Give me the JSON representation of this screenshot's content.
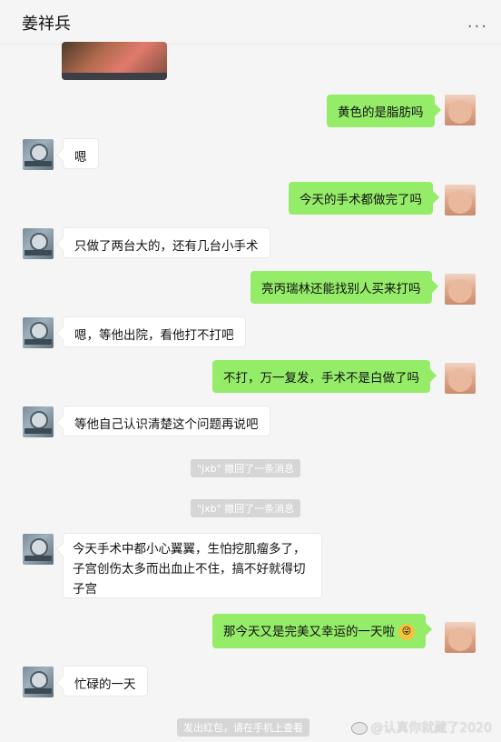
{
  "header": {
    "title": "姜祥兵",
    "more_label": "..."
  },
  "messages": [
    {
      "side": "right",
      "text": "黄色的是脂肪吗"
    },
    {
      "side": "left",
      "text": "嗯"
    },
    {
      "side": "right",
      "text": "今天的手术都做完了吗"
    },
    {
      "side": "left",
      "text": "只做了两台大的，还有几台小手术"
    },
    {
      "side": "right",
      "text": "亮丙瑞林还能找别人买来打吗"
    },
    {
      "side": "left",
      "text": "嗯，等他出院，看他打不打吧"
    },
    {
      "side": "right",
      "text": "不打，万一复发，手术不是白做了吗"
    },
    {
      "side": "left",
      "text": "等他自己认识清楚这个问题再说吧"
    },
    {
      "side": "system",
      "text": "\"jxb\" 撤回了一条消息"
    },
    {
      "side": "system",
      "text": "\"jxb\" 撤回了一条消息"
    },
    {
      "side": "left",
      "text": "今天手术中都小心翼翼，生怕挖肌瘤多了，子宫创伤太多而出血止不住，搞不好就得切子宫"
    },
    {
      "side": "right",
      "text": "那今天又是完美又幸运的一天啦"
    },
    {
      "side": "left",
      "text": "忙碌的一天"
    },
    {
      "side": "system",
      "text": "发出红包，请在手机上查看"
    }
  ],
  "watermark": "@认真你就藏了2020",
  "colors": {
    "self_bubble": "#95ec69",
    "other_bubble": "#ffffff",
    "background": "#f5f5f5"
  }
}
